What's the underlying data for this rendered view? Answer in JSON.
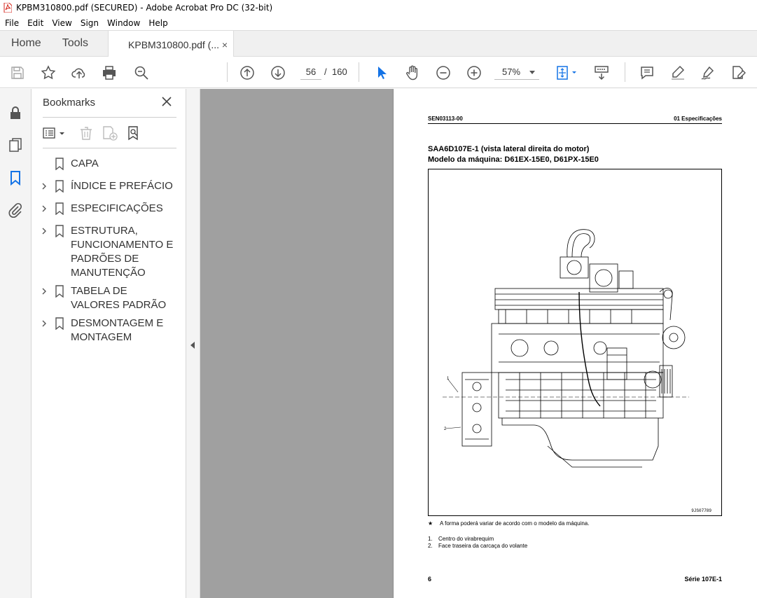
{
  "window": {
    "title": "KPBM310800.pdf (SECURED) - Adobe Acrobat Pro DC (32-bit)"
  },
  "menu": [
    "File",
    "Edit",
    "View",
    "Sign",
    "Window",
    "Help"
  ],
  "tabs": {
    "home": "Home",
    "tools": "Tools",
    "document": "KPBM310800.pdf (...",
    "close": "×"
  },
  "toolbar": {
    "current_page": "56",
    "page_separator": "/",
    "total_pages": "160",
    "zoom": "57%"
  },
  "bookmarks": {
    "title": "Bookmarks",
    "items": [
      {
        "label": "CAPA",
        "expandable": false
      },
      {
        "label": "ÍNDICE E PREFÁCIO",
        "expandable": true
      },
      {
        "label": "ESPECIFICAÇÕES",
        "expandable": true
      },
      {
        "label": "ESTRUTURA, FUNCIONAMENTO E PADRÕES DE MANUTENÇÃO",
        "expandable": true
      },
      {
        "label": "TABELA DE VALORES PADRÃO",
        "expandable": true
      },
      {
        "label": "DESMONTAGEM E MONTAGEM",
        "expandable": true
      }
    ]
  },
  "page": {
    "header_left": "SEN03113-00",
    "header_right": "01 Especificações",
    "title_line1": "SAA6D107E-1 (vista lateral direita do motor)",
    "title_line2": "Modelo da máquina: D61EX-15E0, D61PX-15E0",
    "figure_id": "9JS07789",
    "note_star": "★",
    "note_text": "A forma poderá variar de acordo com o modelo da máquina.",
    "legend": [
      {
        "num": "1.",
        "text": "Centro do virabrequim"
      },
      {
        "num": "2.",
        "text": "Face traseira da carcaça do volante"
      }
    ],
    "footer_left": "6",
    "footer_right": "Série 107E-1"
  },
  "colors": {
    "acrobat_red": "#d4261c",
    "active_blue": "#1473e6",
    "doc_gray": "#a0a0a0"
  }
}
